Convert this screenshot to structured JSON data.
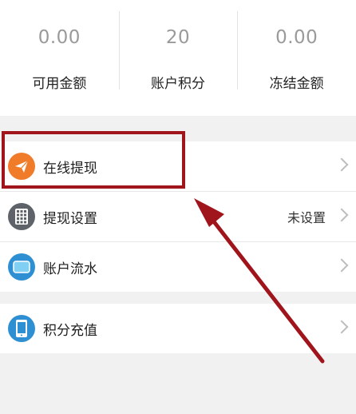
{
  "stats": [
    {
      "value": "0.00",
      "label": "可用金额"
    },
    {
      "value": "20",
      "label": "账户积分"
    },
    {
      "value": "0.00",
      "label": "冻结金额"
    }
  ],
  "menu": {
    "withdraw_online": {
      "label": "在线提现",
      "icon": "paper-plane-icon"
    },
    "withdraw_settings": {
      "label": "提现设置",
      "value": "未设置",
      "icon": "keypad-icon"
    },
    "account_flow": {
      "label": "账户流水",
      "icon": "card-icon"
    },
    "points_recharge": {
      "label": "积分充值",
      "icon": "phone-icon"
    }
  },
  "colors": {
    "annotation": "#a0141b",
    "orange_icon": "#f07c2a",
    "gray_icon": "#5d6368",
    "blue_icon": "#2e8fd2"
  }
}
